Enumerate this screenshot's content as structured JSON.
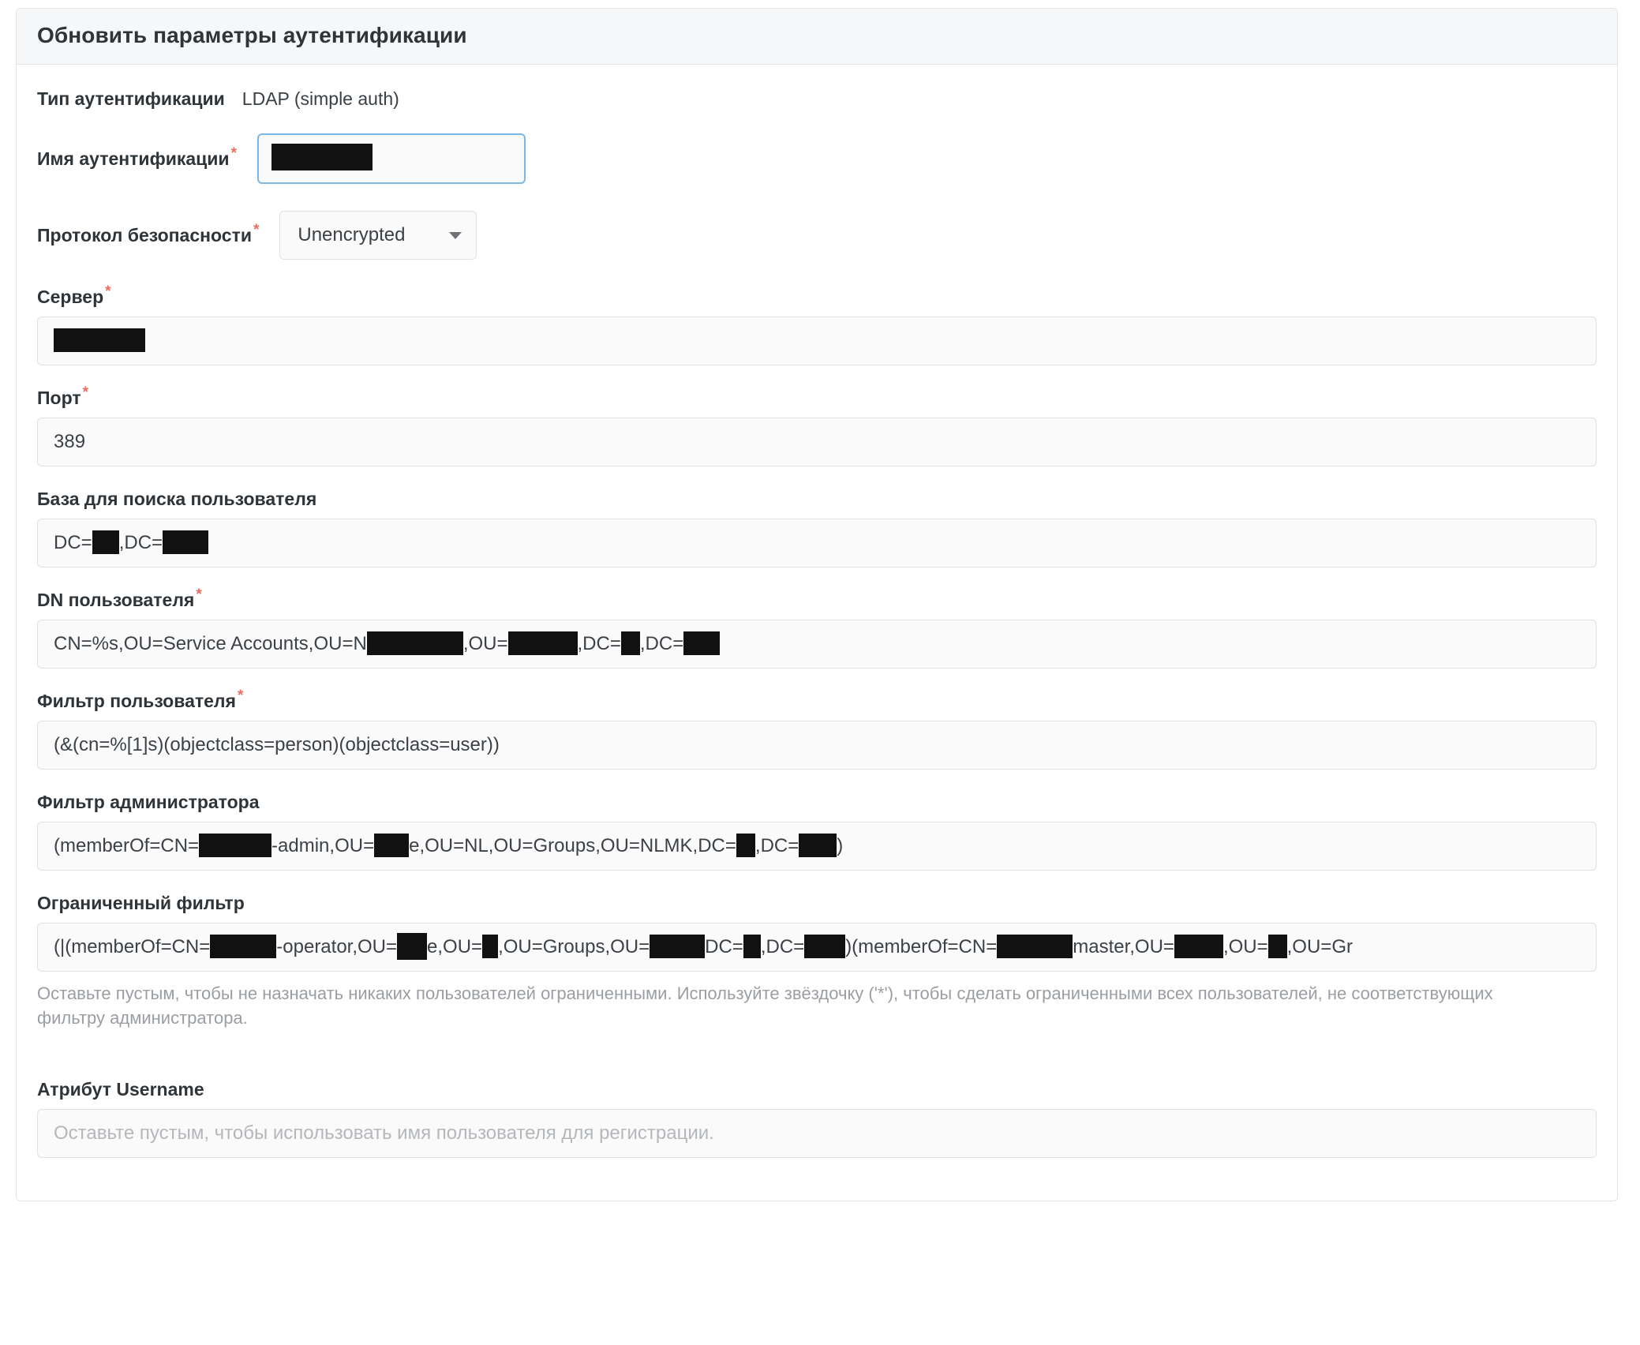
{
  "card": {
    "title": "Обновить параметры аутентификации"
  },
  "fields": {
    "auth_type": {
      "label": "Тип аутентификации",
      "value": "LDAP (simple auth)"
    },
    "auth_name": {
      "label": "Имя аутентификации",
      "required": true,
      "value": "",
      "redacted": true
    },
    "security_protocol": {
      "label": "Протокол безопасности",
      "required": true,
      "value": "Unencrypted",
      "caret_icon": "chevron-down-icon"
    },
    "host": {
      "label": "Сервер",
      "required": true,
      "value": "",
      "redacted": true
    },
    "port": {
      "label": "Порт",
      "required": true,
      "value": "389"
    },
    "user_search_base": {
      "label": "База для поиска пользователя",
      "required": false,
      "parts": [
        "DC=",
        "[redacted]",
        ",DC=",
        "[redacted]"
      ]
    },
    "user_dn": {
      "label": "DN пользователя",
      "required": true,
      "parts": [
        "CN=%s,OU=Service Accounts,OU=N",
        "[redacted]",
        ",OU=",
        "[redacted]",
        ",DC=",
        "[redacted]",
        ",DC=",
        "[redacted]"
      ]
    },
    "user_filter": {
      "label": "Фильтр пользователя",
      "required": true,
      "value": "(&(cn=%[1]s)(objectclass=person)(objectclass=user))"
    },
    "admin_filter": {
      "label": "Фильтр администратора",
      "required": false,
      "parts": [
        "(memberOf=CN=",
        "[redacted]",
        "-admin,OU=",
        "[redacted]",
        "e,OU=NL,OU=Groups,OU=NLMK,DC=",
        "[redacted]",
        ",DC=",
        "[redacted]",
        ")"
      ]
    },
    "restricted_filter": {
      "label": "Ограниченный фильтр",
      "required": false,
      "parts": [
        "(|(memberOf=CN=",
        "[redacted]",
        "-operator,OU=",
        "[redacted]",
        "e,OU=",
        "[redacted]",
        ",OU=Groups,OU=",
        "[redacted]",
        "DC=",
        "[redacted]",
        ",DC=",
        "[redacted]",
        ")(memberOf=CN=",
        "[redacted]",
        "master,OU=",
        "[redacted]",
        ",OU=",
        "[redacted]",
        ",OU=Gr"
      ],
      "helper": "Оставьте пустым, чтобы не назначать никаких пользователей ограниченными. Используйте звёздочку ('*'), чтобы сделать ограниченными всех пользователей, не соответствующих фильтру администратора."
    },
    "username_attribute": {
      "label": "Атрибут Username",
      "required": false,
      "placeholder": "Оставьте пустым, чтобы использовать имя пользователя для регистрации."
    }
  },
  "colors": {
    "accent_focus": "#79b8e8",
    "required_star": "#f06b5e",
    "field_bg": "#fafafa",
    "header_bg": "#f6f7f8",
    "border": "#e3e4e6"
  }
}
